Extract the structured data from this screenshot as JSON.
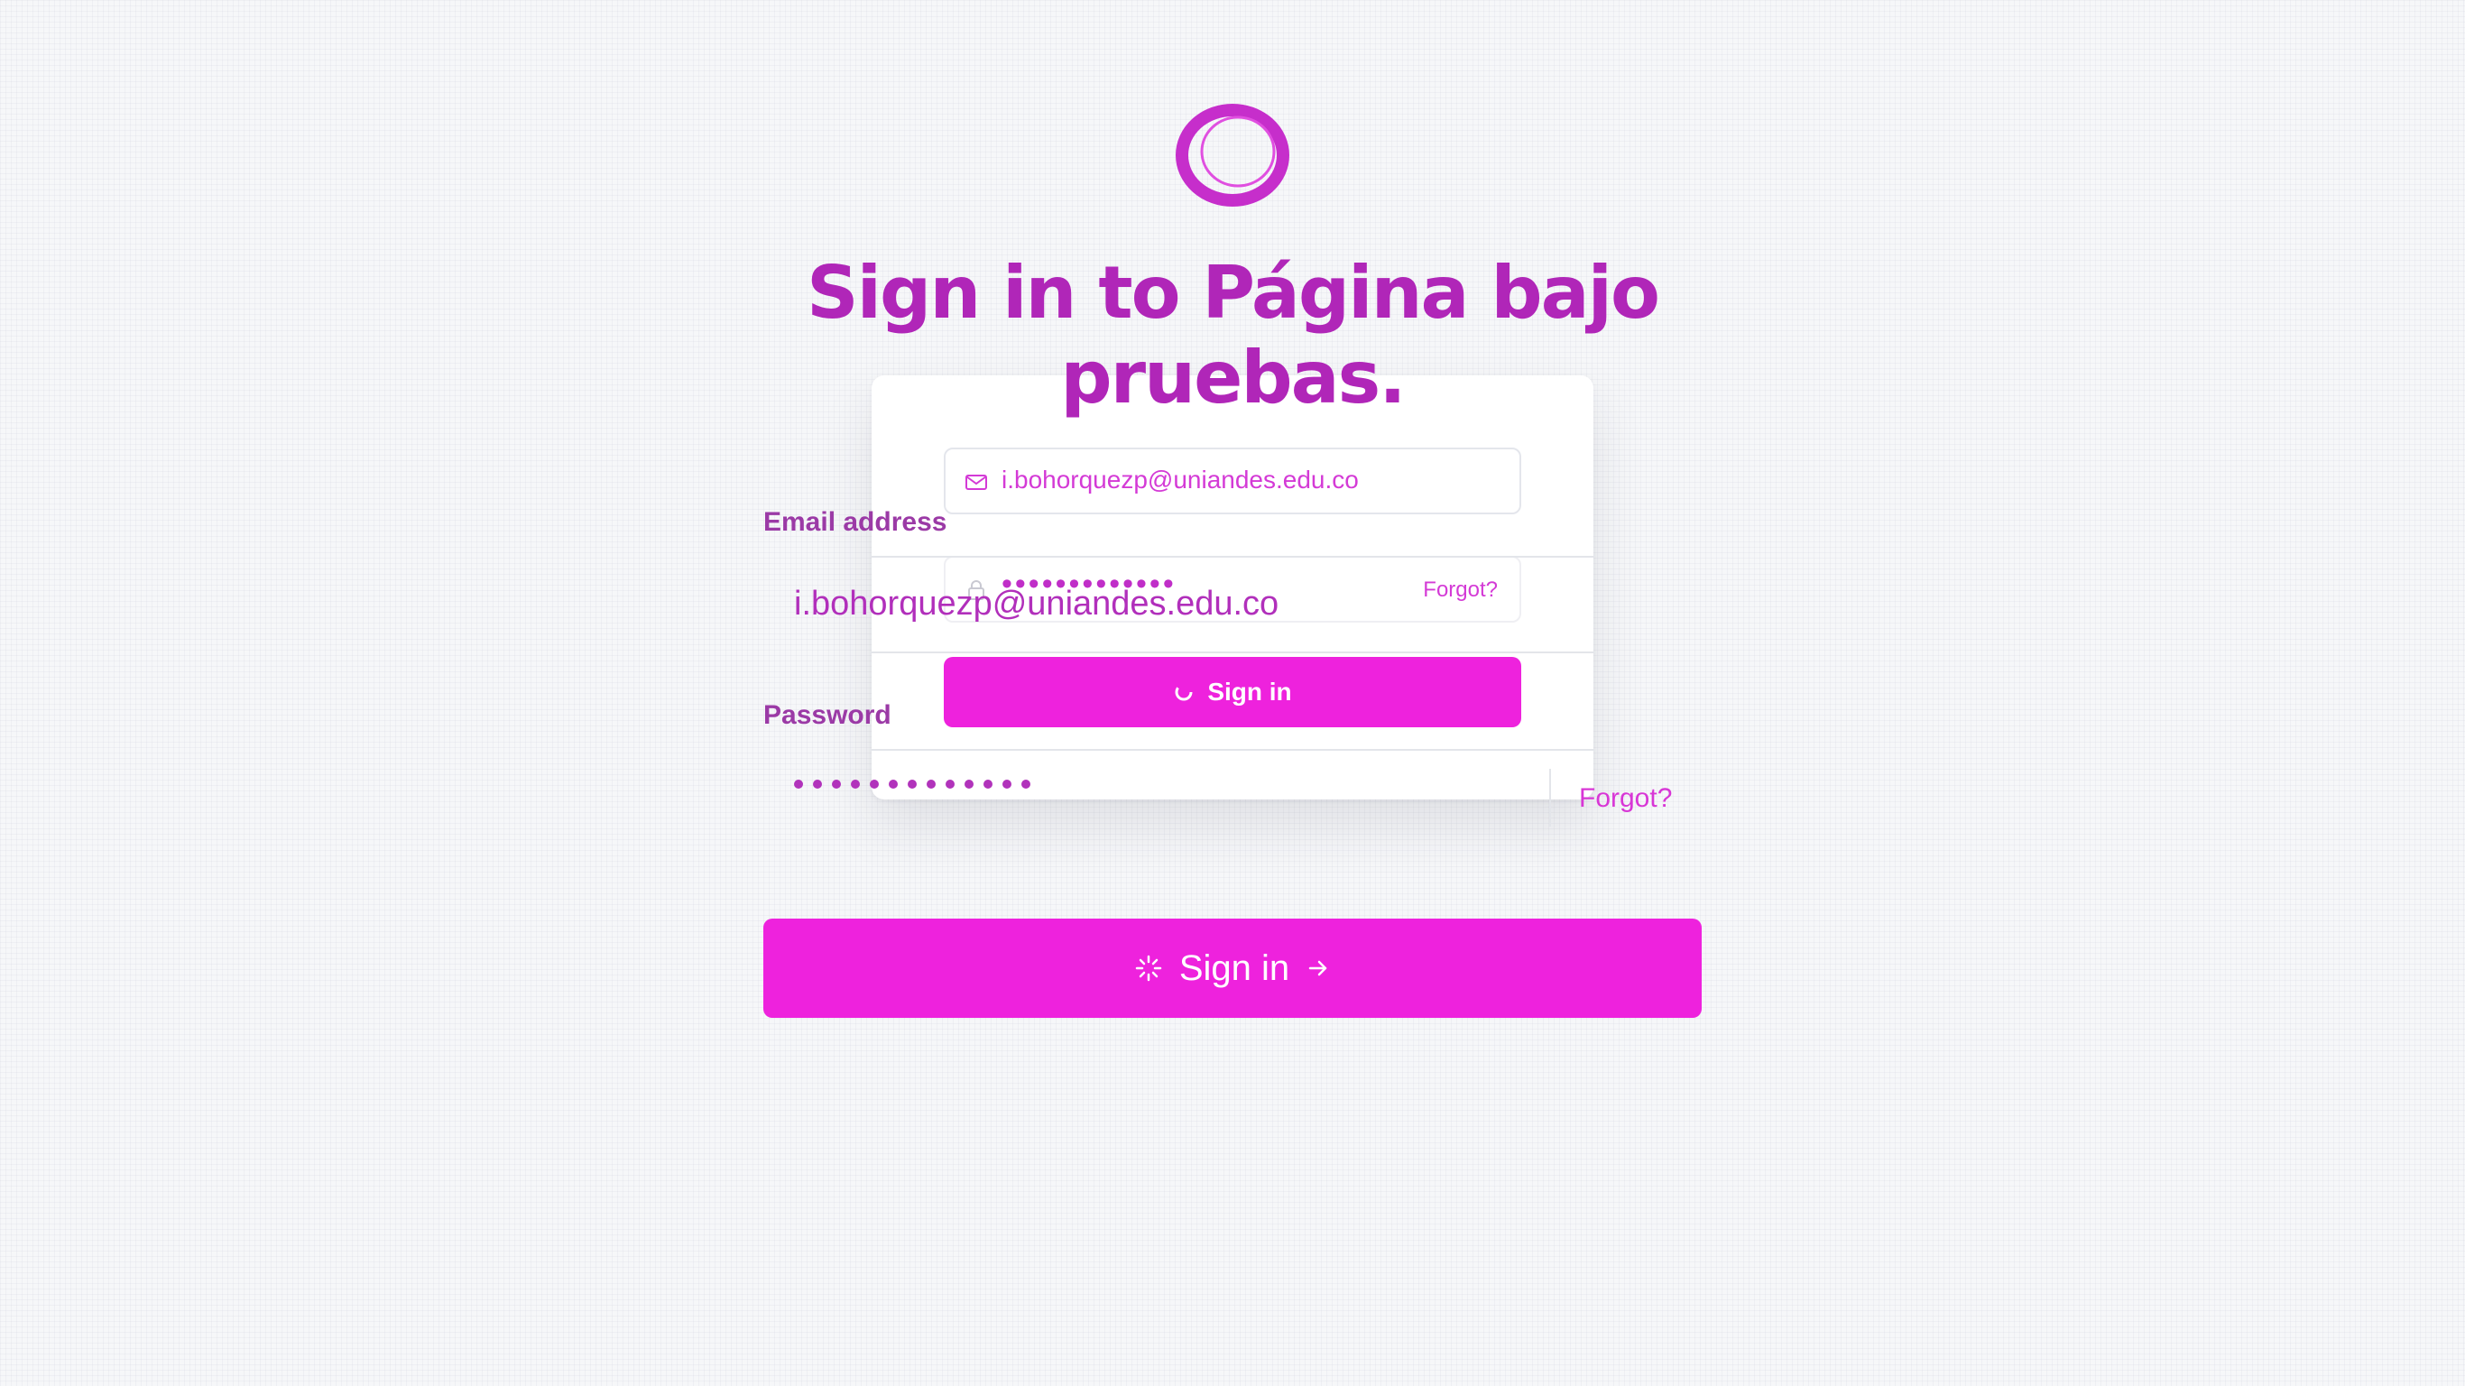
{
  "brand": {
    "logo_icon": "ring-logo-icon",
    "accent": "#ee22dd",
    "title_color": "#b026b8"
  },
  "page": {
    "title": "Sign in to Página bajo pruebas."
  },
  "ghost_form": {
    "email_value": "i.bohorquezp@uniandes.edu.co",
    "password_mask": "•••••••••••••",
    "forgot_label": "Forgot?",
    "submit_label": "Sign in"
  },
  "form": {
    "email_label": "Email address",
    "email_value": "i.bohorquezp@uniandes.edu.co",
    "password_label": "Password",
    "forgot_label": "Forgot?",
    "submit_label": "Sign in",
    "icons": {
      "email": "mail-icon",
      "password": "lock-icon",
      "submit_spinner": "spinner-icon",
      "submit_arrow": "arrow-right-icon"
    }
  }
}
